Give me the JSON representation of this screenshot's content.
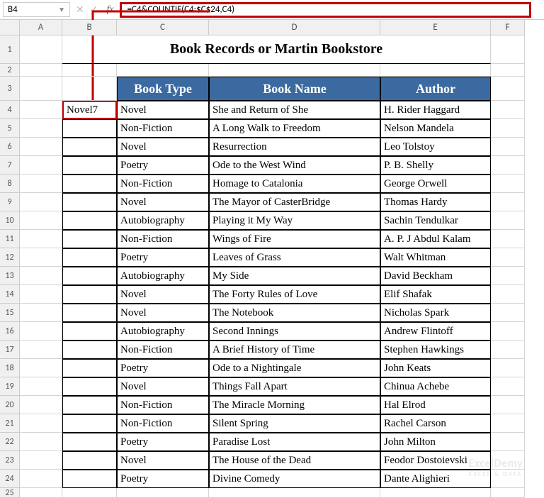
{
  "namebox": {
    "value": "B4"
  },
  "formula_bar": {
    "value": "=C4&COUNTIF(C4:$C$24,C4)"
  },
  "fx": {
    "label": "fx"
  },
  "columns": [
    "",
    "A",
    "B",
    "C",
    "D",
    "E",
    "F"
  ],
  "rows": [
    "1",
    "2",
    "3",
    "4",
    "5",
    "6",
    "7",
    "8",
    "9",
    "10",
    "11",
    "12",
    "13",
    "14",
    "15",
    "16",
    "17",
    "18",
    "19",
    "20",
    "21",
    "22",
    "23",
    "24",
    "25"
  ],
  "title": "Book Records or Martin Bookstore",
  "headers": {
    "type": "Book Type",
    "name": "Book Name",
    "author": "Author"
  },
  "b4_value": "Novel7",
  "data": [
    {
      "type": "Novel",
      "name": "She and Return of She",
      "author": "H. Rider Haggard"
    },
    {
      "type": "Non-Fiction",
      "name": "A Long Walk to Freedom",
      "author": "Nelson Mandela"
    },
    {
      "type": "Novel",
      "name": "Resurrection",
      "author": "Leo Tolstoy"
    },
    {
      "type": "Poetry",
      "name": "Ode to the West Wind",
      "author": "P. B. Shelly"
    },
    {
      "type": "Non-Fiction",
      "name": "Homage to Catalonia",
      "author": "George Orwell"
    },
    {
      "type": "Novel",
      "name": "The Mayor of CasterBridge",
      "author": "Thomas Hardy"
    },
    {
      "type": "Autobiography",
      "name": "Playing it My Way",
      "author": "Sachin Tendulkar"
    },
    {
      "type": "Non-Fiction",
      "name": "Wings of Fire",
      "author": "A. P. J Abdul Kalam"
    },
    {
      "type": "Poetry",
      "name": "Leaves of Grass",
      "author": "Walt Whitman"
    },
    {
      "type": "Autobiography",
      "name": "My Side",
      "author": "David Beckham"
    },
    {
      "type": "Novel",
      "name": "The Forty Rules of Love",
      "author": "Elif Shafak"
    },
    {
      "type": "Novel",
      "name": "The Notebook",
      "author": "Nicholas Spark"
    },
    {
      "type": "Autobiography",
      "name": "Second Innings",
      "author": "Andrew Flintoff"
    },
    {
      "type": "Non-Fiction",
      "name": "A Brief History of Time",
      "author": "Stephen Hawkings"
    },
    {
      "type": "Poetry",
      "name": "Ode to a Nightingale",
      "author": "John Keats"
    },
    {
      "type": "Novel",
      "name": "Things Fall Apart",
      "author": "Chinua Achebe"
    },
    {
      "type": "Non-Fiction",
      "name": "The Miracle Morning",
      "author": "Hal Elrod"
    },
    {
      "type": "Non-Fiction",
      "name": "Silent Spring",
      "author": "Rachel Carson"
    },
    {
      "type": "Poetry",
      "name": "Paradise Lost",
      "author": "John Milton"
    },
    {
      "type": "Novel",
      "name": "The House of the Dead",
      "author": "Feodor Dostoievski"
    },
    {
      "type": "Poetry",
      "name": "Divine Comedy",
      "author": "Dante Alighieri"
    }
  ],
  "watermark": {
    "top": "ExcelDemy",
    "bottom": "EXCEL & DATA"
  }
}
